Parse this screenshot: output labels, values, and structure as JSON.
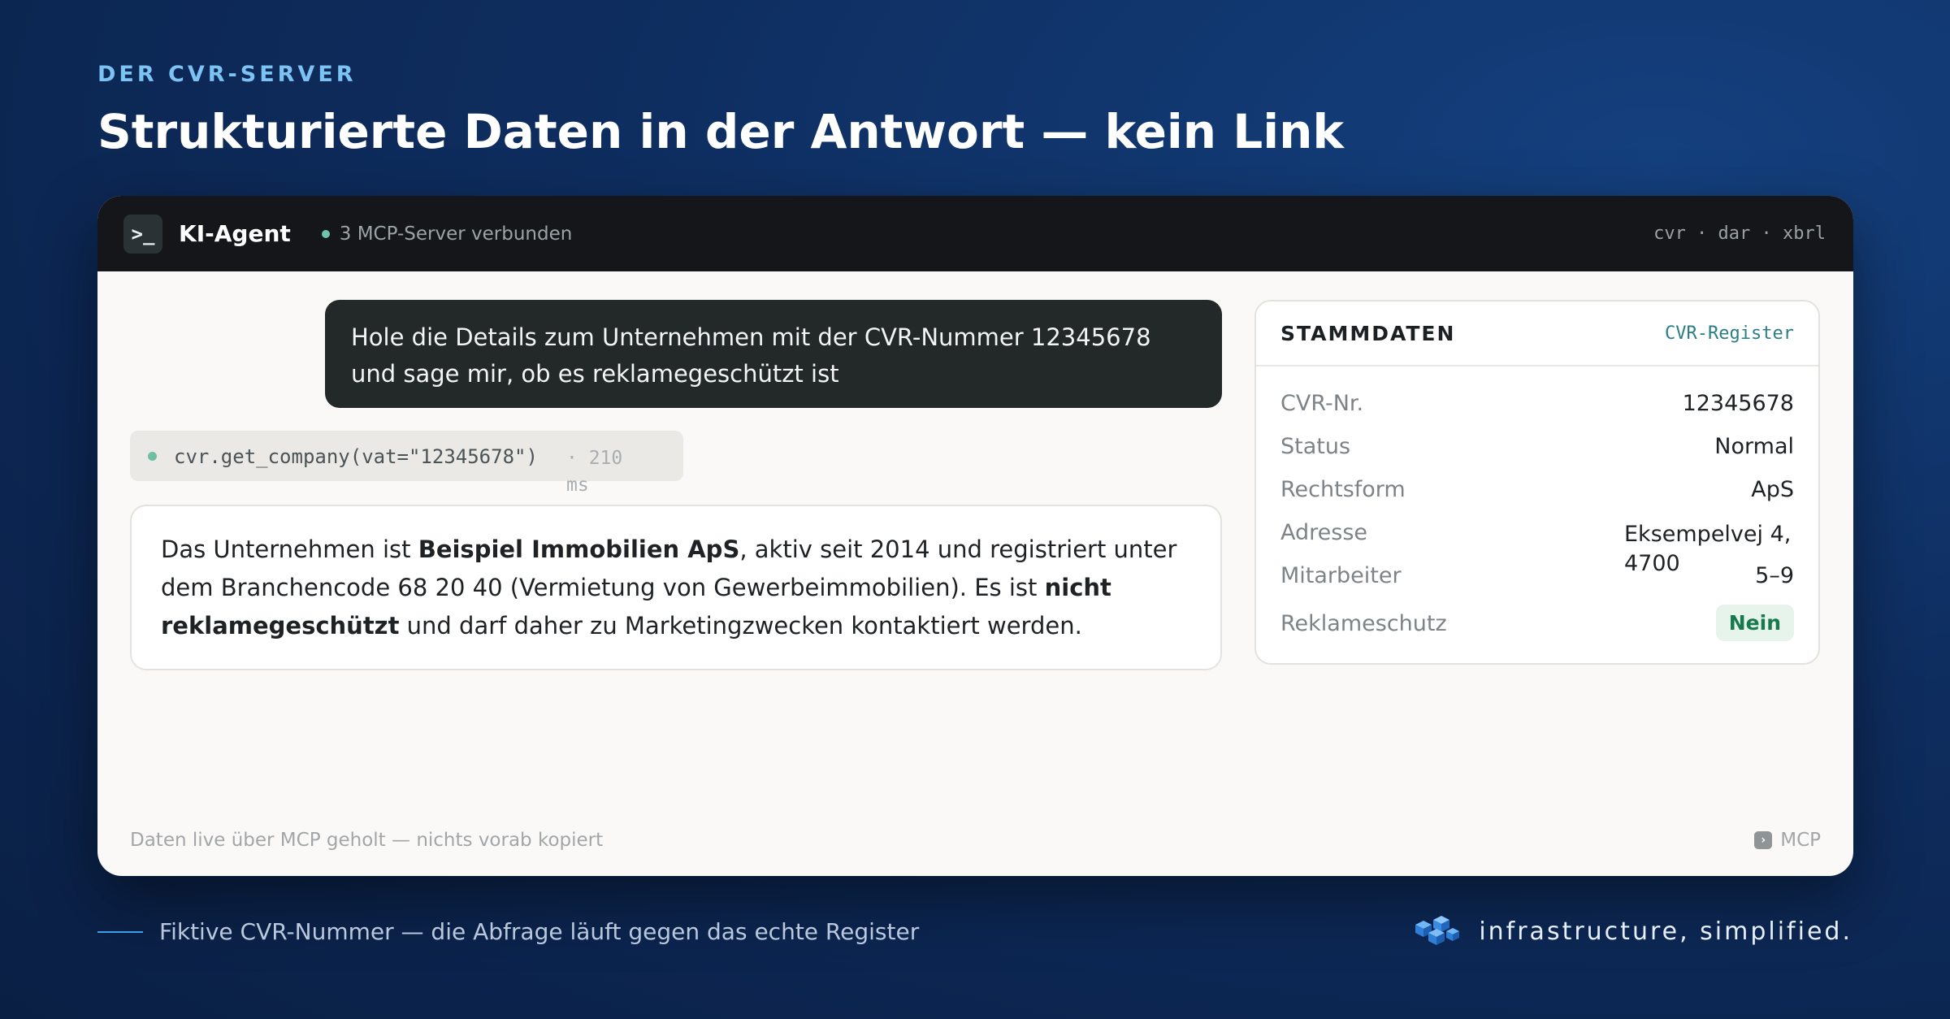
{
  "slide": {
    "eyebrow": "DER CVR-SERVER",
    "headline": "Strukturierte Daten in der Antwort — kein Link",
    "footnote": "Fiktive CVR-Nummer — die Abfrage läuft gegen das echte Register",
    "brand": "infrastructure, simplified."
  },
  "window": {
    "agent_name": "KI-Agent",
    "status": "3 MCP-Server verbunden",
    "servers": "cvr · dar · xbrl",
    "footer": "Daten live über MCP geholt — nichts vorab kopiert",
    "footer_badge": "MCP"
  },
  "chat": {
    "user_message": "Hole die Details zum Unternehmen mit der CVR-Nummer 12345678 und sage mir, ob es reklamegeschützt ist",
    "tool_call": "cvr.get_company(vat=\"12345678\")",
    "tool_time": "· 210 ms",
    "answer": {
      "part1": "Das Unternehmen ist ",
      "company": "Beispiel Immobilien ApS",
      "part2": ", aktiv seit 2014 und registriert unter dem Branchencode 68 20 40 (Vermietung von Gewerbeimmobilien). Es ist ",
      "emphasis": "nicht reklamegeschützt",
      "part3": " und darf daher zu Marketingzwecken kontaktiert werden."
    }
  },
  "stammdaten": {
    "title": "STAMMDATEN",
    "source": "CVR-Register",
    "fields": [
      {
        "label": "CVR-Nr.",
        "value": "12345678"
      },
      {
        "label": "Status",
        "value": "Normal"
      },
      {
        "label": "Rechtsform",
        "value": "ApS"
      },
      {
        "label": "Adresse",
        "value": "Eksempelvej 4, 4700"
      },
      {
        "label": "Mitarbeiter",
        "value": "5–9"
      },
      {
        "label": "Reklameschutz",
        "value": "Nein"
      }
    ]
  },
  "colors": {
    "accent": "#7cc2f2",
    "status_dot": "#6fc4a6",
    "source_link": "#2b7e86",
    "badge_bg": "#e6f4ec",
    "badge_text": "#17794c"
  }
}
